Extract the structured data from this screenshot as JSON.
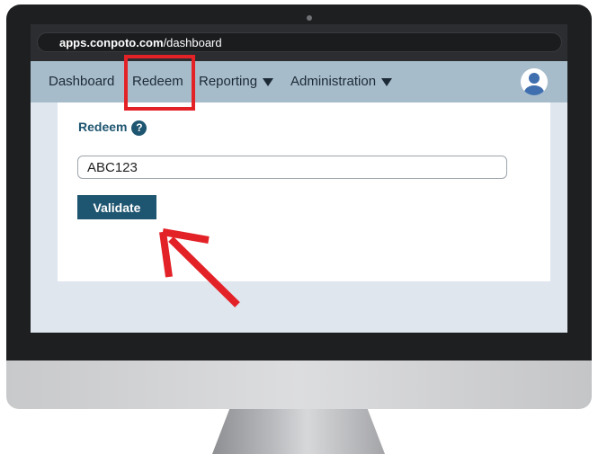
{
  "browser": {
    "url_host": "apps.conpoto.com",
    "url_path": "/dashboard"
  },
  "nav": {
    "items": [
      {
        "label": "Dashboard",
        "has_dropdown": false
      },
      {
        "label": "Redeem",
        "has_dropdown": false,
        "highlighted": true
      },
      {
        "label": "Reporting",
        "has_dropdown": true
      },
      {
        "label": "Administration",
        "has_dropdown": true
      }
    ],
    "avatar_icon": "user-avatar-icon"
  },
  "redeem": {
    "heading": "Redeem",
    "help_icon": "?",
    "code_value": "ABC123",
    "validate_label": "Validate"
  },
  "colors": {
    "navbar": "#a7bccb",
    "accent": "#1e5570",
    "annotation": "#e32228",
    "bezel": "#1e1f21"
  }
}
